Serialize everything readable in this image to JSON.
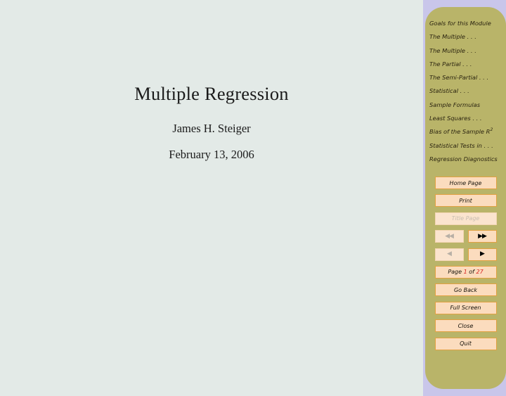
{
  "document": {
    "title": "Multiple Regression",
    "author": "James H. Steiger",
    "date": "February 13, 2006"
  },
  "colors": {
    "page_background": "#e3eae7",
    "panel_background": "#b9b469",
    "panel_outer_strip": "#c9c6ea",
    "button_fill": "#fbdcbe",
    "button_border": "#e2a141",
    "page_number_accent": "#d81f1f",
    "toc_text": "#2b2410"
  },
  "nav_panel": {
    "toc": {
      "items": [
        {
          "label": "Goals for this Module"
        },
        {
          "label": "The Multiple . . ."
        },
        {
          "label": "The Multiple . . ."
        },
        {
          "label": "The Partial . . ."
        },
        {
          "label": "The Semi-Partial . . ."
        },
        {
          "label": "Statistical . . ."
        },
        {
          "label": "Sample Formulas"
        },
        {
          "label": "Least Squares . . ."
        },
        {
          "label": "Bias of the Sample R",
          "superscript": "2",
          "has_math": true
        },
        {
          "label": "Statistical Tests in . . ."
        },
        {
          "label": "Regression Diagnostics"
        }
      ]
    },
    "buttons": {
      "home_page": "Home Page",
      "print": "Print",
      "title_page": "Title Page",
      "first_page_glyph": "◀◀",
      "last_page_glyph": "▶▶",
      "prev_page_glyph": "◀",
      "next_page_glyph": "▶",
      "go_back": "Go Back",
      "full_screen": "Full Screen",
      "close": "Close",
      "quit": "Quit"
    },
    "page_indicator": {
      "prefix": "Page",
      "current": "1",
      "middle": "of",
      "total": "27"
    }
  }
}
